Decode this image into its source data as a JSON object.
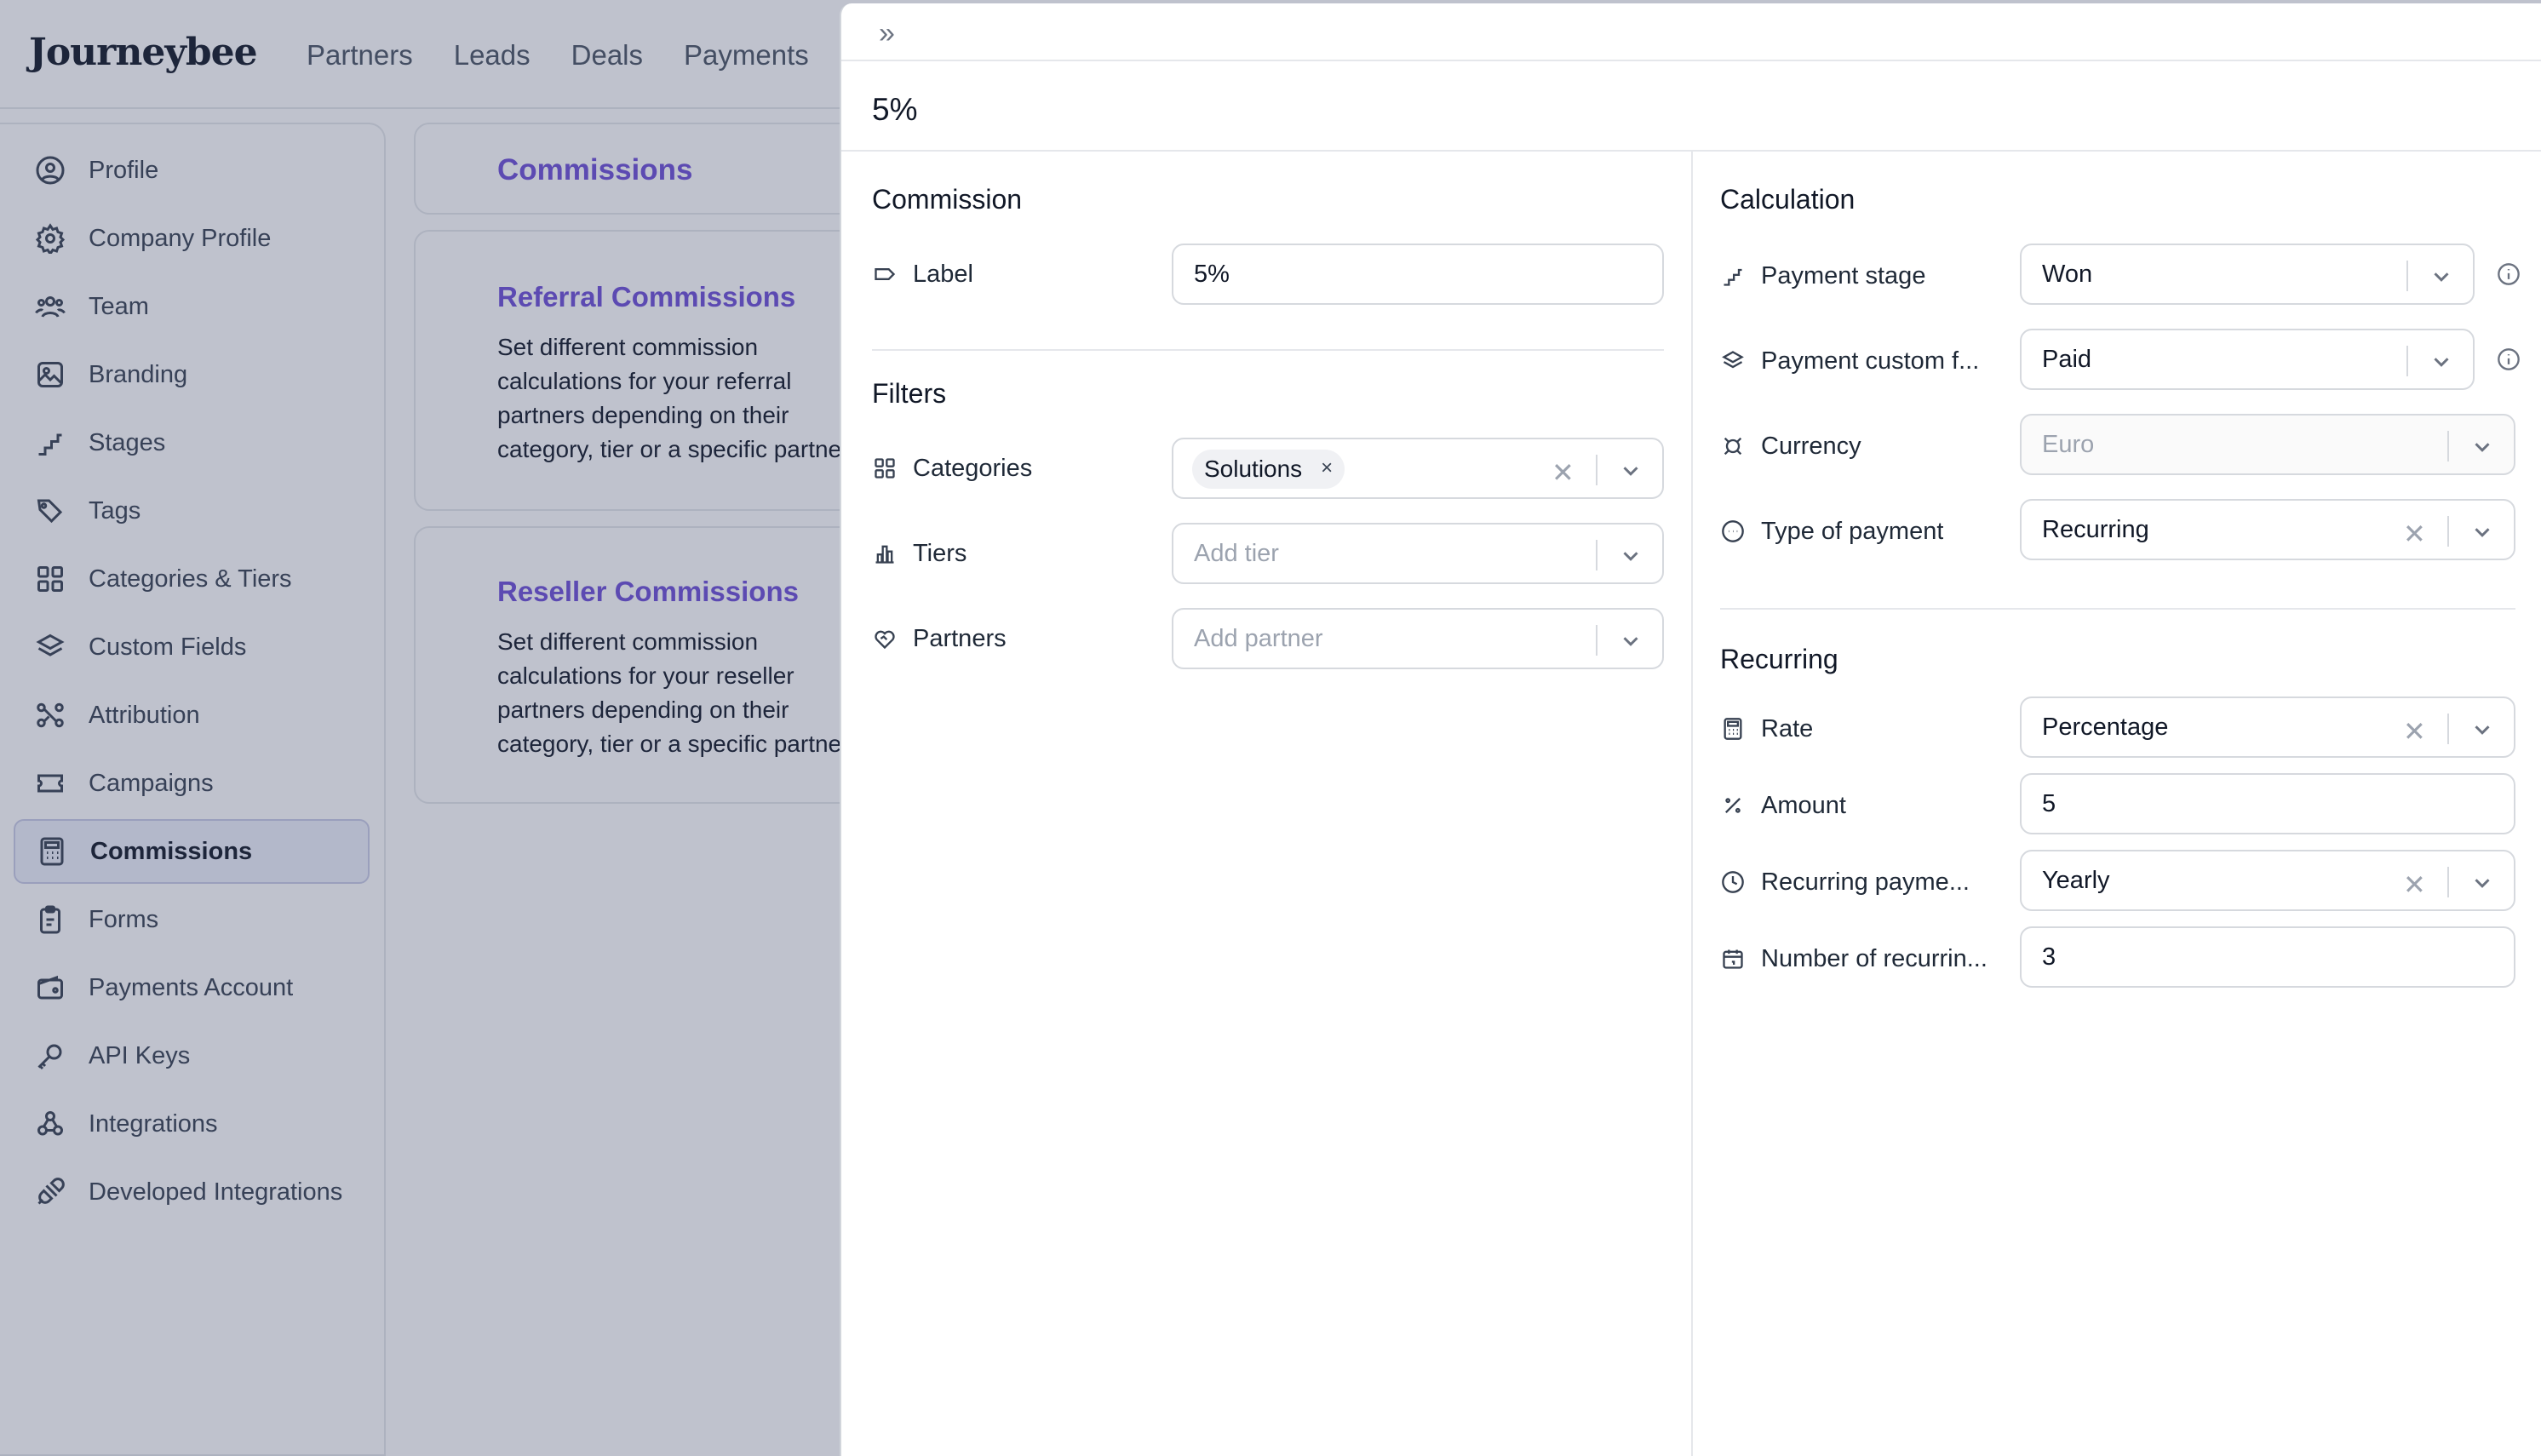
{
  "app": {
    "logo": "Journeybee",
    "nav": [
      "Partners",
      "Leads",
      "Deals",
      "Payments"
    ]
  },
  "sidebar": {
    "items": [
      {
        "label": "Profile",
        "icon": "user-circle-icon"
      },
      {
        "label": "Company Profile",
        "icon": "gear-icon"
      },
      {
        "label": "Team",
        "icon": "team-icon"
      },
      {
        "label": "Branding",
        "icon": "image-icon"
      },
      {
        "label": "Stages",
        "icon": "stairs-icon"
      },
      {
        "label": "Tags",
        "icon": "tags-icon"
      },
      {
        "label": "Categories & Tiers",
        "icon": "grid-icon"
      },
      {
        "label": "Custom Fields",
        "icon": "layers-icon"
      },
      {
        "label": "Attribution",
        "icon": "attribution-icon"
      },
      {
        "label": "Campaigns",
        "icon": "ticket-icon"
      },
      {
        "label": "Commissions",
        "icon": "calculator-icon",
        "active": true
      },
      {
        "label": "Forms",
        "icon": "clipboard-icon"
      },
      {
        "label": "Payments Account",
        "icon": "wallet-icon"
      },
      {
        "label": "API Keys",
        "icon": "key-icon"
      },
      {
        "label": "Integrations",
        "icon": "webhook-icon"
      },
      {
        "label": "Developed Integrations",
        "icon": "plug-icon"
      }
    ]
  },
  "main": {
    "header": "Commissions",
    "cards": [
      {
        "title": "Referral Commissions",
        "lines": [
          "Set different commission",
          "calculations for your referral",
          "partners depending on their",
          "category, tier or a specific partner"
        ]
      },
      {
        "title": "Reseller Commissions",
        "lines": [
          "Set different commission",
          "calculations for your reseller",
          "partners depending on their",
          "category, tier or a specific partner"
        ]
      }
    ]
  },
  "panel": {
    "collapse_glyph": "»",
    "title": "5%",
    "commission": {
      "section": "Commission",
      "label_field": {
        "label": "Label",
        "value": "5%"
      }
    },
    "filters": {
      "section": "Filters",
      "categories": {
        "label": "Categories",
        "chip": "Solutions",
        "chip_remove": "×"
      },
      "tiers": {
        "label": "Tiers",
        "placeholder": "Add tier"
      },
      "partners": {
        "label": "Partners",
        "placeholder": "Add partner"
      }
    },
    "calculation": {
      "section": "Calculation",
      "payment_stage": {
        "label": "Payment stage",
        "value": "Won"
      },
      "payment_custom_field": {
        "label": "Payment custom f...",
        "value": "Paid"
      },
      "currency": {
        "label": "Currency",
        "value": "Euro"
      },
      "type_of_payment": {
        "label": "Type of payment",
        "value": "Recurring"
      }
    },
    "recurring": {
      "section": "Recurring",
      "rate": {
        "label": "Rate",
        "value": "Percentage"
      },
      "amount": {
        "label": "Amount",
        "value": "5"
      },
      "recurring_payment": {
        "label": "Recurring payme...",
        "value": "Yearly"
      },
      "number_of_recurring": {
        "label": "Number of recurrin...",
        "value": "3"
      }
    },
    "clear_glyph": "✕"
  }
}
